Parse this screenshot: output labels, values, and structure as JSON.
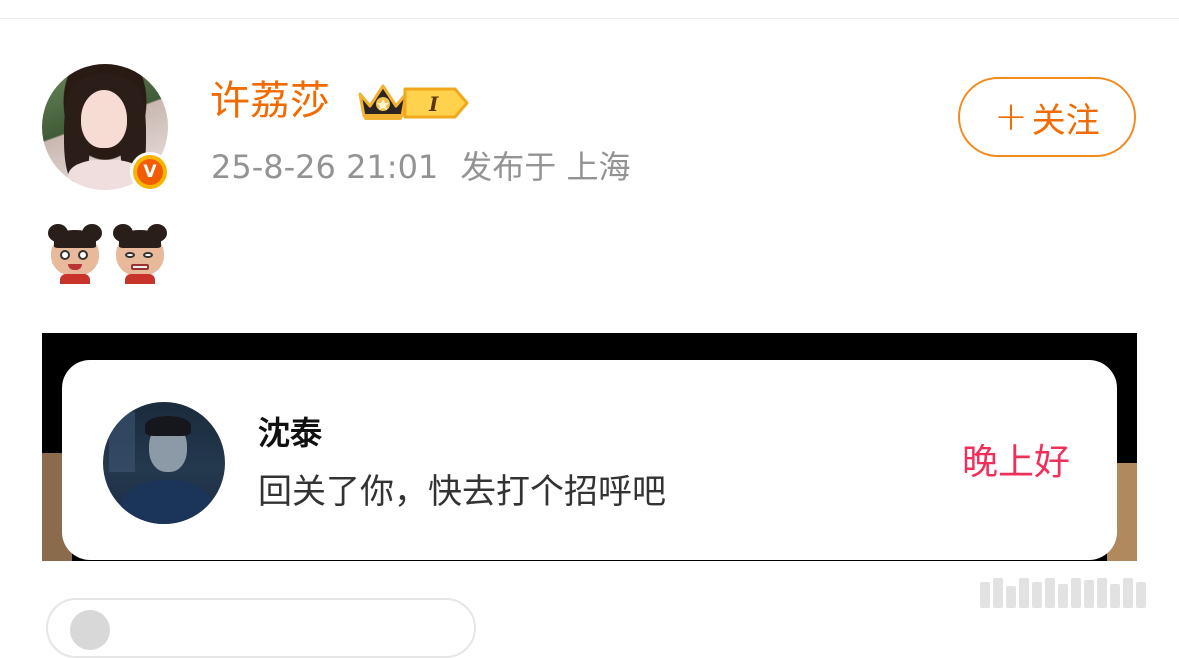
{
  "post": {
    "author_name": "许荔莎",
    "level_label": "I",
    "timestamp": "25-8-26 21:01",
    "location": "发布于 上海",
    "follow_label": "关注",
    "follow_plus": "+",
    "verified_mark": "V",
    "emojis": [
      "nezha-smile-icon",
      "nezha-grimace-icon"
    ]
  },
  "embedded_notification": {
    "sender_name": "沈泰",
    "message": "回关了你，快去打个招呼吧",
    "action_label": "晚上好"
  },
  "colors": {
    "accent_orange": "#f26b00",
    "follow_border": "#f28a1d",
    "meta_gray": "#939393",
    "action_red": "#f0305a"
  }
}
